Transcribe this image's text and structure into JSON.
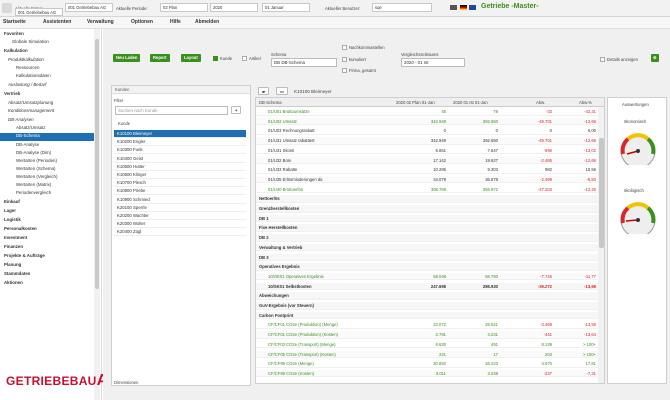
{
  "topbar": {
    "firm_label": "Aktuelle Firma:",
    "firm_value": "001 Getriebebau AG",
    "firm_value2": "001 Getriebebau AG",
    "period_label": "Aktuelle Periode:",
    "period_value": "02 Plan",
    "year_value": "2020",
    "month_value": "01 Januar",
    "user_label": "Aktueller Benutzer:",
    "user_value": "sqe",
    "brand": "Getriebe -Master-"
  },
  "menu": {
    "start": "Startseite",
    "assistants": "Assistenten",
    "admin": "Verwaltung",
    "options": "Optionen",
    "help": "Hilfe",
    "logout": "Abmelden"
  },
  "sidebar": {
    "rows": [
      "Favoriten",
      "Globale Simulation",
      "Kalkulation",
      "Produktkalkulation",
      "Ressourcen",
      "Kalkulationsdaten",
      "Auslastung / Bedarf",
      "Vertrieb",
      "Absatz/Umsatzplanung",
      "Konditionsmanagement",
      "DB-Analysen",
      "Absatz/Umsatz",
      "DB-Schema",
      "DB-Analyse",
      "DB-Analyse (Dim)",
      "Wertarten (Perioden)",
      "Wertarten (Schema)",
      "Wertarten (Vergleich)",
      "Wertarten (Matrix)",
      "Periodenvergleich",
      "Einkauf",
      "Lager",
      "Logistik",
      "Personalkosten",
      "Investment",
      "Finanzen",
      "Projekte & Aufträge",
      "Planung",
      "Stammdaten",
      "Aktionen"
    ],
    "logo_text": "GETRIEBEBAU",
    "logo_suffix": "AG"
  },
  "toolbar": {
    "new_load": "Neu Laden",
    "report": "Report",
    "layout": "Layout",
    "kunde": "Kunde",
    "artikel": "Artikel",
    "schema_label": "Schema",
    "schema_value": "DB DB-Schema",
    "nachkommastellen": "Nachkommastellen",
    "kumuliert": "kumuliert",
    "firma_gesamt": "Firma, gesamt",
    "vergleich_label": "Vergleichszeitraums",
    "vergleich_value": "2020 - 01 Ist",
    "details": "Details anzeigen"
  },
  "customer_panel": {
    "title": "Kunden",
    "filter_label": "Filter",
    "search_placeholder": "Suchen nach Kunde",
    "column": "Kunde",
    "rows": [
      "K10100 Bleimeyer",
      "K10200 Engler",
      "K10300 Funk",
      "K10400 Geist",
      "K10500 Hutter",
      "K10600 Klinger",
      "K10700 Plesch",
      "K10800 Priebe",
      "K10900 Schmied",
      "K20100 Sperrle",
      "K20200 Wachter",
      "K20300 Wolter",
      "K20400 Zügl"
    ],
    "footer": "Dimensionen"
  },
  "grid": {
    "breadcrumb": "K10100 Bleimeyer",
    "headers": [
      "DB-Schema",
      "2020 02 Plan 01-Jan",
      "2020 01 Ist 01-Jan",
      "Abw.",
      "Abw.%"
    ],
    "rows": [
      {
        "label": "01/U01 Bruttoumsätze",
        "a": "45",
        "b": "78",
        "c": "-33",
        "d": "-42,31",
        "kind": "green"
      },
      {
        "label": "01/U02 Umsatz",
        "a": "342.949",
        "b": "392.550",
        "c": "-49.701",
        "d": "-12,66",
        "kind": "green"
      },
      {
        "label": "01/U03 Rechnungsrabatt",
        "a": "0",
        "b": "0",
        "c": "0",
        "d": "0,00",
        "kind": ""
      },
      {
        "label": "01/U31 Umsatz rabattiert",
        "a": "342.949",
        "b": "392.550",
        "c": "-49.701",
        "d": "-12,66",
        "kind": ""
      },
      {
        "label": "01/U31 Skonti",
        "a": "6.651",
        "b": "7.647",
        "c": "-996",
        "d": "-13,02",
        "kind": ""
      },
      {
        "label": "01/U32 Boni",
        "a": "17.142",
        "b": "19.627",
        "c": "-2.485",
        "d": "-12,66",
        "kind": ""
      },
      {
        "label": "01/U33 Rabatte",
        "a": "10.285",
        "b": "9.303",
        "c": "982",
        "d": "10,56",
        "kind": ""
      },
      {
        "label": "01/U35 Erlösminderungen dir.",
        "a": "34.079",
        "b": "36.578",
        "c": "-2.499",
        "d": "-6,83",
        "kind": ""
      },
      {
        "label": "01/U40 Bruttoerlös",
        "a": "308.769",
        "b": "355.972",
        "c": "-47.203",
        "d": "-13,26",
        "kind": "green"
      },
      {
        "label": "Nettoerlös",
        "a": "",
        "b": "",
        "c": "",
        "d": "",
        "kind": "group"
      },
      {
        "label": "Grenzherstellkosten",
        "a": "",
        "b": "",
        "c": "",
        "d": "",
        "kind": "group"
      },
      {
        "label": "DB 1",
        "a": "",
        "b": "",
        "c": "",
        "d": "",
        "kind": "group"
      },
      {
        "label": "Fixe Herstellkosten",
        "a": "",
        "b": "",
        "c": "",
        "d": "",
        "kind": "group"
      },
      {
        "label": "DB 2",
        "a": "",
        "b": "",
        "c": "",
        "d": "",
        "kind": "group"
      },
      {
        "label": "Verwaltung & Vertrieb",
        "a": "",
        "b": "",
        "c": "",
        "d": "",
        "kind": "group"
      },
      {
        "label": "DB 3",
        "a": "",
        "b": "",
        "c": "",
        "d": "",
        "kind": "group"
      },
      {
        "label": "Operatives Ergebnis",
        "a": "",
        "b": "",
        "c": "",
        "d": "",
        "kind": "group"
      },
      {
        "label": "10/OE01 Operatives Ergebnis",
        "a": "58.048",
        "b": "65.793",
        "c": "-7.745",
        "d": "-11,77",
        "kind": "green"
      },
      {
        "label": "10/SK01 Selbstkosten",
        "a": "247.698",
        "b": "286.930",
        "c": "-39.272",
        "d": "-13,69",
        "kind": "bold"
      },
      {
        "label": "Abweichungen",
        "a": "",
        "b": "",
        "c": "",
        "d": "",
        "kind": "group"
      },
      {
        "label": "GuV-Ergebnis (vor Steuern)",
        "a": "",
        "b": "",
        "c": "",
        "d": "",
        "kind": "group"
      },
      {
        "label": "Carbon Footprint",
        "a": "",
        "b": "",
        "c": "",
        "d": "",
        "kind": "group"
      },
      {
        "label": "CF/CF01 CO2e (Produktion) (Menge)",
        "a": "22.072",
        "b": "25.541",
        "c": "-3.469",
        "d": "-13,58",
        "kind": "green"
      },
      {
        "label": "CF/CF01 CO2e (Produktion) (Kosten)",
        "a": "2.791",
        "b": "3.231",
        "c": "-441",
        "d": "-13,64",
        "kind": "green"
      },
      {
        "label": "CF/CF03 CO2e (Transport) (Menge)",
        "a": "8.630",
        "b": "491",
        "c": "8.139",
        "d": "> 100+",
        "kind": "green"
      },
      {
        "label": "CF/CF05 CO2e (Transport) (Kosten)",
        "a": "221",
        "b": "17",
        "c": "203",
        "d": "> 100+",
        "kind": "green"
      },
      {
        "label": "CF/CF99 CO2e (Menge)",
        "a": "30.892",
        "b": "26.223",
        "c": "4.670",
        "d": "17,81",
        "kind": "green"
      },
      {
        "label": "CF/CF99 CO2e (Kosten)",
        "a": "3.011",
        "b": "3.248",
        "c": "-237",
        "d": "-7,31",
        "kind": "green"
      }
    ]
  },
  "gauges": {
    "title": "Auswertungen",
    "eco": "ökonomisch",
    "ecol": "ökologisch"
  },
  "colors": {
    "accent": "#3a8f1e",
    "select": "#1f6fb3",
    "negative": "#d9262b"
  }
}
